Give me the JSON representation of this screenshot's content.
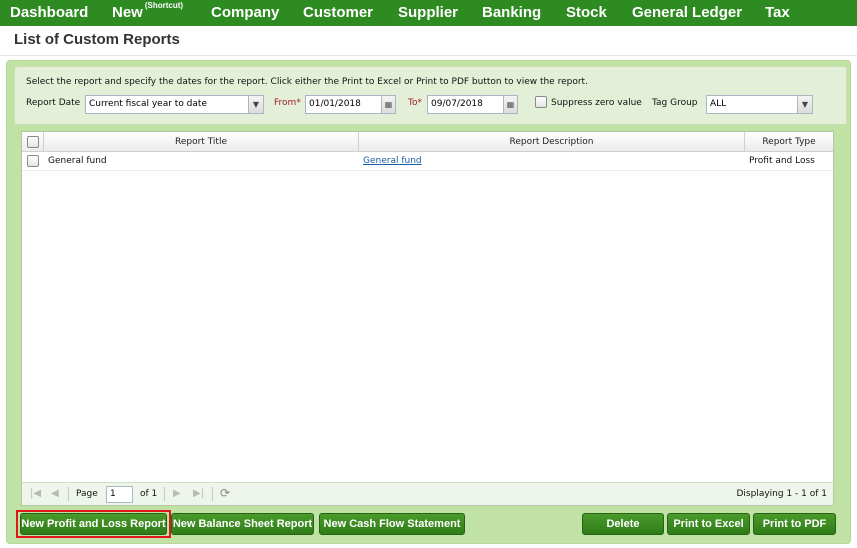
{
  "nav": {
    "dashboard": "Dashboard",
    "new": "New",
    "new_sup": "(Shortcut)",
    "company": "Company",
    "customer": "Customer",
    "supplier": "Supplier",
    "banking": "Banking",
    "stock": "Stock",
    "general_ledger": "General Ledger",
    "tax": "Tax"
  },
  "page_title": "List of Custom Reports",
  "filter": {
    "instructions": "Select the report and specify the dates for the report. Click either the Print to Excel or Print to PDF button to view the report.",
    "report_date_label": "Report Date",
    "report_date_value": "Current fiscal year to date",
    "from_label": "From",
    "from_value": "01/01/2018",
    "to_label": "To",
    "to_value": "09/07/2018",
    "required_mark": "*",
    "suppress_label": "Suppress zero value",
    "suppress_checked": false,
    "tag_group_label": "Tag Group",
    "tag_group_value": "ALL"
  },
  "grid": {
    "columns": [
      "Report Title",
      "Report Description",
      "Report Type"
    ],
    "rows": [
      {
        "title": "General fund",
        "description": "General fund",
        "type": "Profit and Loss",
        "checked": false
      }
    ]
  },
  "pager": {
    "page_label": "Page",
    "page_value": "1",
    "of_label": "of 1",
    "displaying": "Displaying 1 - 1 of 1"
  },
  "buttons": {
    "new_pl": "New Profit and Loss Report",
    "new_bs": "New Balance Sheet Report",
    "new_cf": "New Cash Flow Statement",
    "delete": "Delete",
    "print_excel": "Print to Excel",
    "print_pdf": "Print to PDF"
  },
  "colors": {
    "nav_bg": "#2e8b22",
    "panel_bg": "#c1e2a5",
    "button_bg": "#3a8c22",
    "highlight": "#e0161a",
    "link": "#1a5aa6"
  }
}
